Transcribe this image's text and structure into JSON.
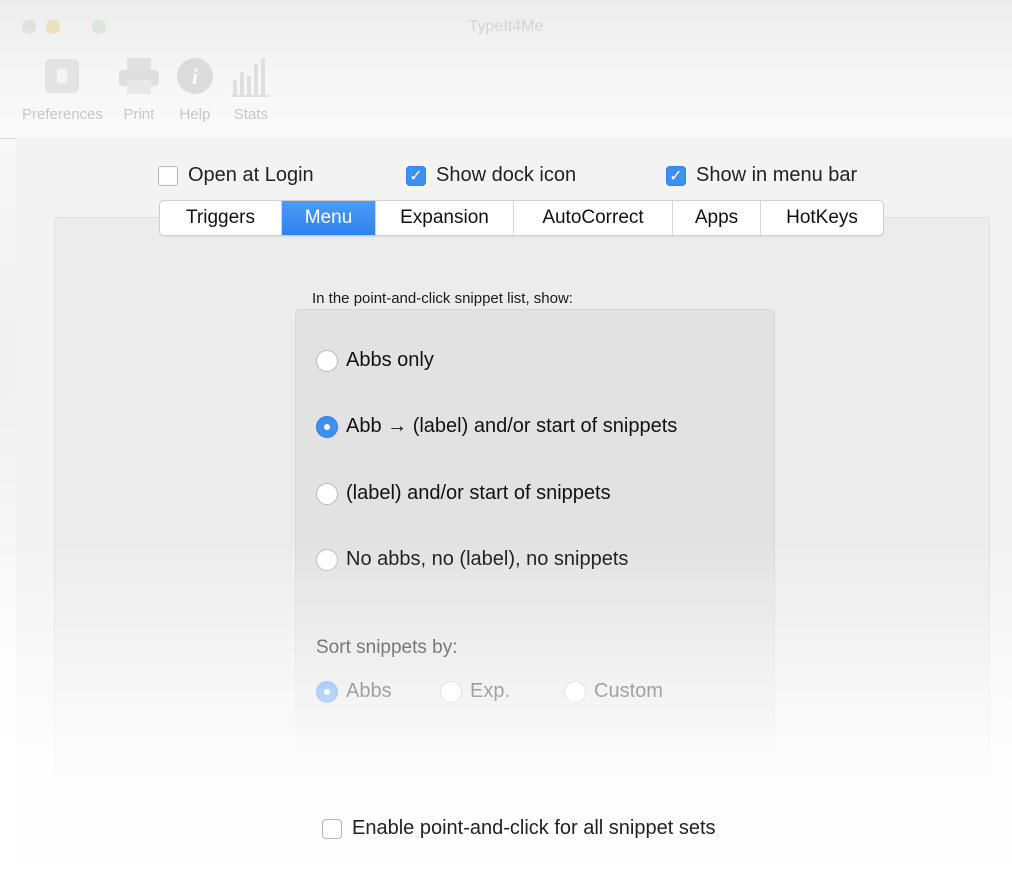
{
  "window": {
    "title": "TypeIt4Me"
  },
  "toolbar": {
    "items": [
      {
        "label": "Preferences",
        "icon": "switch-icon"
      },
      {
        "label": "Print",
        "icon": "printer-icon"
      },
      {
        "label": "Help",
        "icon": "info-icon"
      },
      {
        "label": "Stats",
        "icon": "bar-chart-icon"
      }
    ]
  },
  "options": {
    "open_at_login": {
      "label": "Open at Login",
      "checked": false
    },
    "show_dock_icon": {
      "label": "Show dock icon",
      "checked": true
    },
    "show_in_menu_bar": {
      "label": "Show in menu bar",
      "checked": true
    }
  },
  "tabs": [
    {
      "label": "Triggers",
      "active": false
    },
    {
      "label": "Menu",
      "active": true
    },
    {
      "label": "Expansion",
      "active": false
    },
    {
      "label": "AutoCorrect",
      "active": false
    },
    {
      "label": "Apps",
      "active": false
    },
    {
      "label": "HotKeys",
      "active": false
    }
  ],
  "menu": {
    "caption": "In the point-and-click snippet list, show:",
    "display_options": [
      {
        "label": "Abbs only",
        "selected": false
      },
      {
        "label": "Abb → (label) and/or start of snippets",
        "selected": true
      },
      {
        "label": "(label) and/or start of snippets",
        "selected": false
      },
      {
        "label": "No abbs, no (label), no snippets",
        "selected": false
      }
    ],
    "sort_label": "Sort snippets by:",
    "sort_options": [
      {
        "label": "Abbs",
        "selected": true
      },
      {
        "label": "Exp.",
        "selected": false
      },
      {
        "label": "Custom",
        "selected": false
      }
    ],
    "enable_all": {
      "label": "Enable point-and-click for all snippet sets",
      "checked": false
    }
  },
  "colors": {
    "accent": "#3d8ff0",
    "panel": "#e2e2e2",
    "background": "#f3f3f3"
  }
}
